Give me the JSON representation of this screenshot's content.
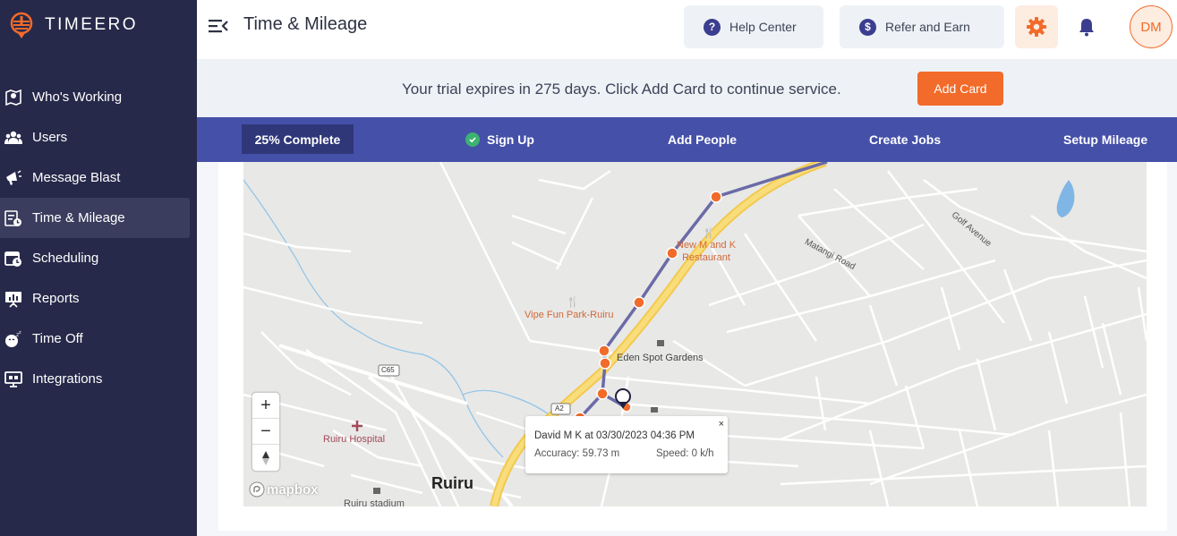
{
  "app": {
    "name": "TIMEERO"
  },
  "sidebar": {
    "items": [
      {
        "label": "Who's Working",
        "icon": "map-pin-icon"
      },
      {
        "label": "Users",
        "icon": "users-icon"
      },
      {
        "label": "Message Blast",
        "icon": "megaphone-icon"
      },
      {
        "label": "Time & Mileage",
        "icon": "timesheet-icon",
        "active": true
      },
      {
        "label": "Scheduling",
        "icon": "calendar-clock-icon"
      },
      {
        "label": "Reports",
        "icon": "presentation-chart-icon"
      },
      {
        "label": "Time Off",
        "icon": "time-off-icon"
      },
      {
        "label": "Integrations",
        "icon": "monitor-integrations-icon"
      }
    ]
  },
  "header": {
    "title": "Time & Mileage",
    "help_label": "Help Center",
    "refer_label": "Refer and Earn",
    "avatar_initials": "DM"
  },
  "trial": {
    "message": "Your trial expires in 275 days. Click Add Card to continue service.",
    "button_label": "Add Card"
  },
  "onboarding": {
    "percent_label": "25% Complete",
    "steps": [
      {
        "label": "Sign Up",
        "done": true
      },
      {
        "label": "Add People",
        "done": false
      },
      {
        "label": "Create Jobs",
        "done": false
      },
      {
        "label": "Setup Mileage",
        "done": false
      }
    ]
  },
  "map": {
    "labels": {
      "restaurant": "New M and K\nRestaurant",
      "restaurant_l1": "New M and K",
      "restaurant_l2": "Restaurant",
      "park": "Vipe Fun Park-Ruiru",
      "gardens": "Eden Spot Gardens",
      "hospital": "Ruiru Hospital",
      "town": "Ruiru",
      "stadium": "Ruiru stadium",
      "road_golf": "Golf Avenue",
      "road_matangi": "Matangi Road",
      "shield_c65": "C65",
      "shield_a2": "A2"
    },
    "popup": {
      "title": "David M K at 03/30/2023 04:36 PM",
      "accuracy": "Accuracy: 59.73 m",
      "speed": "Speed: 0 k/h",
      "close": "×"
    },
    "attribution": "mapbox",
    "zoom_in": "+",
    "zoom_out": "−"
  },
  "colors": {
    "sidebar_bg": "#27294a",
    "accent_orange": "#f26b2a",
    "progress_bg": "#4550a8",
    "route": "#6b6ba8"
  }
}
